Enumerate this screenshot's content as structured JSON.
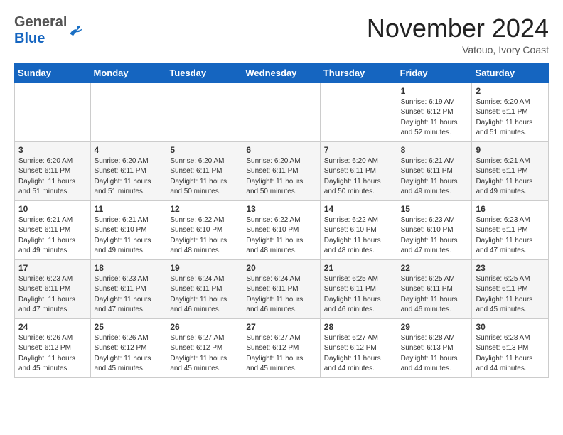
{
  "header": {
    "logo_general": "General",
    "logo_blue": "Blue",
    "month_title": "November 2024",
    "location": "Vatouo, Ivory Coast"
  },
  "calendar": {
    "days_of_week": [
      "Sunday",
      "Monday",
      "Tuesday",
      "Wednesday",
      "Thursday",
      "Friday",
      "Saturday"
    ],
    "weeks": [
      [
        {
          "day": "",
          "info": ""
        },
        {
          "day": "",
          "info": ""
        },
        {
          "day": "",
          "info": ""
        },
        {
          "day": "",
          "info": ""
        },
        {
          "day": "",
          "info": ""
        },
        {
          "day": "1",
          "info": "Sunrise: 6:19 AM\nSunset: 6:12 PM\nDaylight: 11 hours\nand 52 minutes."
        },
        {
          "day": "2",
          "info": "Sunrise: 6:20 AM\nSunset: 6:11 PM\nDaylight: 11 hours\nand 51 minutes."
        }
      ],
      [
        {
          "day": "3",
          "info": "Sunrise: 6:20 AM\nSunset: 6:11 PM\nDaylight: 11 hours\nand 51 minutes."
        },
        {
          "day": "4",
          "info": "Sunrise: 6:20 AM\nSunset: 6:11 PM\nDaylight: 11 hours\nand 51 minutes."
        },
        {
          "day": "5",
          "info": "Sunrise: 6:20 AM\nSunset: 6:11 PM\nDaylight: 11 hours\nand 50 minutes."
        },
        {
          "day": "6",
          "info": "Sunrise: 6:20 AM\nSunset: 6:11 PM\nDaylight: 11 hours\nand 50 minutes."
        },
        {
          "day": "7",
          "info": "Sunrise: 6:20 AM\nSunset: 6:11 PM\nDaylight: 11 hours\nand 50 minutes."
        },
        {
          "day": "8",
          "info": "Sunrise: 6:21 AM\nSunset: 6:11 PM\nDaylight: 11 hours\nand 49 minutes."
        },
        {
          "day": "9",
          "info": "Sunrise: 6:21 AM\nSunset: 6:11 PM\nDaylight: 11 hours\nand 49 minutes."
        }
      ],
      [
        {
          "day": "10",
          "info": "Sunrise: 6:21 AM\nSunset: 6:11 PM\nDaylight: 11 hours\nand 49 minutes."
        },
        {
          "day": "11",
          "info": "Sunrise: 6:21 AM\nSunset: 6:10 PM\nDaylight: 11 hours\nand 49 minutes."
        },
        {
          "day": "12",
          "info": "Sunrise: 6:22 AM\nSunset: 6:10 PM\nDaylight: 11 hours\nand 48 minutes."
        },
        {
          "day": "13",
          "info": "Sunrise: 6:22 AM\nSunset: 6:10 PM\nDaylight: 11 hours\nand 48 minutes."
        },
        {
          "day": "14",
          "info": "Sunrise: 6:22 AM\nSunset: 6:10 PM\nDaylight: 11 hours\nand 48 minutes."
        },
        {
          "day": "15",
          "info": "Sunrise: 6:23 AM\nSunset: 6:10 PM\nDaylight: 11 hours\nand 47 minutes."
        },
        {
          "day": "16",
          "info": "Sunrise: 6:23 AM\nSunset: 6:11 PM\nDaylight: 11 hours\nand 47 minutes."
        }
      ],
      [
        {
          "day": "17",
          "info": "Sunrise: 6:23 AM\nSunset: 6:11 PM\nDaylight: 11 hours\nand 47 minutes."
        },
        {
          "day": "18",
          "info": "Sunrise: 6:23 AM\nSunset: 6:11 PM\nDaylight: 11 hours\nand 47 minutes."
        },
        {
          "day": "19",
          "info": "Sunrise: 6:24 AM\nSunset: 6:11 PM\nDaylight: 11 hours\nand 46 minutes."
        },
        {
          "day": "20",
          "info": "Sunrise: 6:24 AM\nSunset: 6:11 PM\nDaylight: 11 hours\nand 46 minutes."
        },
        {
          "day": "21",
          "info": "Sunrise: 6:25 AM\nSunset: 6:11 PM\nDaylight: 11 hours\nand 46 minutes."
        },
        {
          "day": "22",
          "info": "Sunrise: 6:25 AM\nSunset: 6:11 PM\nDaylight: 11 hours\nand 46 minutes."
        },
        {
          "day": "23",
          "info": "Sunrise: 6:25 AM\nSunset: 6:11 PM\nDaylight: 11 hours\nand 45 minutes."
        }
      ],
      [
        {
          "day": "24",
          "info": "Sunrise: 6:26 AM\nSunset: 6:12 PM\nDaylight: 11 hours\nand 45 minutes."
        },
        {
          "day": "25",
          "info": "Sunrise: 6:26 AM\nSunset: 6:12 PM\nDaylight: 11 hours\nand 45 minutes."
        },
        {
          "day": "26",
          "info": "Sunrise: 6:27 AM\nSunset: 6:12 PM\nDaylight: 11 hours\nand 45 minutes."
        },
        {
          "day": "27",
          "info": "Sunrise: 6:27 AM\nSunset: 6:12 PM\nDaylight: 11 hours\nand 45 minutes."
        },
        {
          "day": "28",
          "info": "Sunrise: 6:27 AM\nSunset: 6:12 PM\nDaylight: 11 hours\nand 44 minutes."
        },
        {
          "day": "29",
          "info": "Sunrise: 6:28 AM\nSunset: 6:13 PM\nDaylight: 11 hours\nand 44 minutes."
        },
        {
          "day": "30",
          "info": "Sunrise: 6:28 AM\nSunset: 6:13 PM\nDaylight: 11 hours\nand 44 minutes."
        }
      ]
    ]
  }
}
